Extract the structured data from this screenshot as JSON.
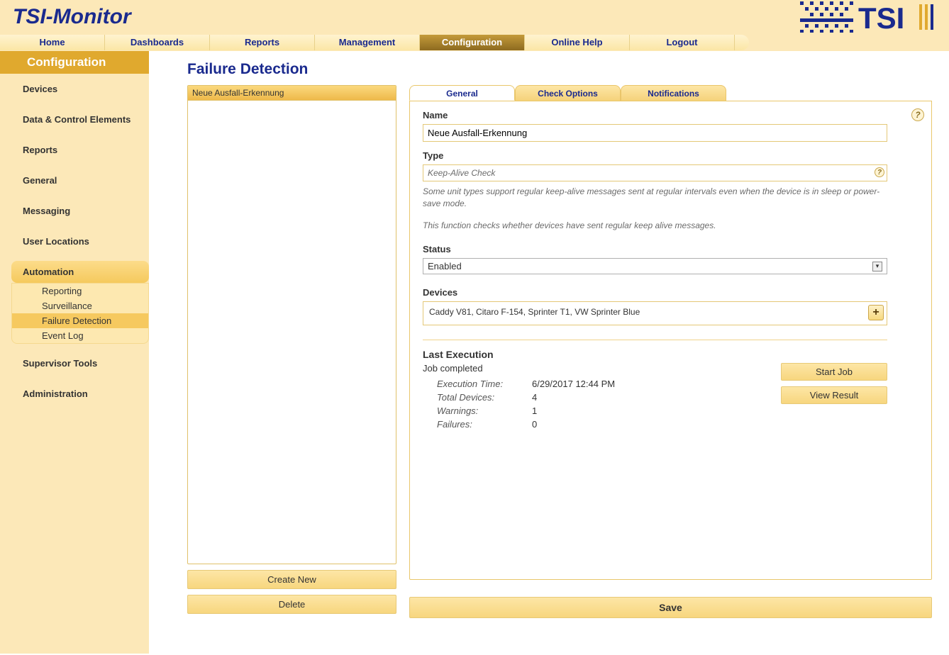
{
  "app": {
    "logo": "TSI-Monitor"
  },
  "topnav": {
    "items": [
      "Home",
      "Dashboards",
      "Reports",
      "Management",
      "Configuration",
      "Online Help",
      "Logout"
    ],
    "active_index": 4
  },
  "sidebar": {
    "title": "Configuration",
    "items": [
      {
        "label": "Devices"
      },
      {
        "label": "Data & Control Elements"
      },
      {
        "label": "Reports"
      },
      {
        "label": "General"
      },
      {
        "label": "Messaging"
      },
      {
        "label": "User Locations"
      },
      {
        "label": "Automation",
        "active": true,
        "children": [
          {
            "label": "Reporting"
          },
          {
            "label": "Surveillance"
          },
          {
            "label": "Failure Detection",
            "active": true
          },
          {
            "label": "Event Log"
          }
        ]
      },
      {
        "label": "Supervisor Tools"
      },
      {
        "label": "Administration"
      }
    ]
  },
  "page": {
    "title": "Failure Detection"
  },
  "list": {
    "header": "Neue Ausfall-Erkennung",
    "create_btn": "Create New",
    "delete_btn": "Delete"
  },
  "tabs": {
    "items": [
      "General",
      "Check Options",
      "Notifications"
    ],
    "active_index": 0
  },
  "form": {
    "name_label": "Name",
    "name_value": "Neue Ausfall-Erkennung",
    "type_label": "Type",
    "type_value": "Keep-Alive Check",
    "type_desc1": "Some unit types support regular keep-alive messages sent at regular intervals even when the device is in sleep or power-save mode.",
    "type_desc2": "This function checks whether devices have sent regular keep alive messages.",
    "status_label": "Status",
    "status_value": "Enabled",
    "devices_label": "Devices",
    "devices_value": "Caddy V81,  Citaro F-154,  Sprinter T1,  VW Sprinter Blue",
    "last_exec_title": "Last Execution",
    "last_exec_status": "Job completed",
    "exec_time_label": "Execution Time:",
    "exec_time_value": "6/29/2017 12:44 PM",
    "total_devices_label": "Total Devices:",
    "total_devices_value": "4",
    "warnings_label": "Warnings:",
    "warnings_value": "1",
    "failures_label": "Failures:",
    "failures_value": "0",
    "start_job_btn": "Start Job",
    "view_result_btn": "View Result",
    "save_btn": "Save"
  }
}
